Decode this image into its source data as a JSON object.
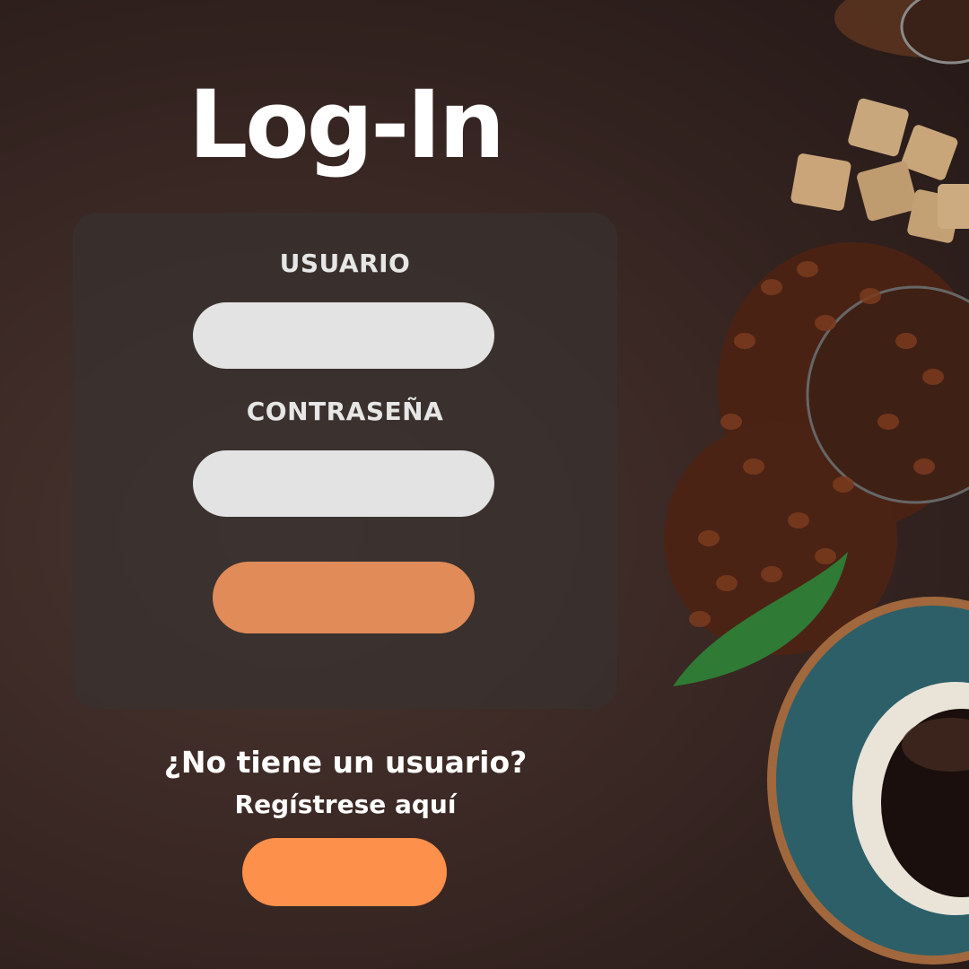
{
  "page": {
    "title": "Log-In"
  },
  "form": {
    "username_label": "USUARIO",
    "username_value": "",
    "password_label": "CONTRASEÑA",
    "password_value": "",
    "submit_label": ""
  },
  "register": {
    "question": "¿No tiene un usuario?",
    "link_text": "Regístrese aquí",
    "button_label": ""
  },
  "colors": {
    "background": "#3a2925",
    "panel": "#37322f",
    "input": "#e3e3e3",
    "login_button": "#e08b58",
    "register_button": "#fd904a"
  },
  "icons": [
    "coffee-beans-decoration",
    "sugar-cubes-decoration",
    "coffee-cup-decoration",
    "leaf-decoration"
  ]
}
